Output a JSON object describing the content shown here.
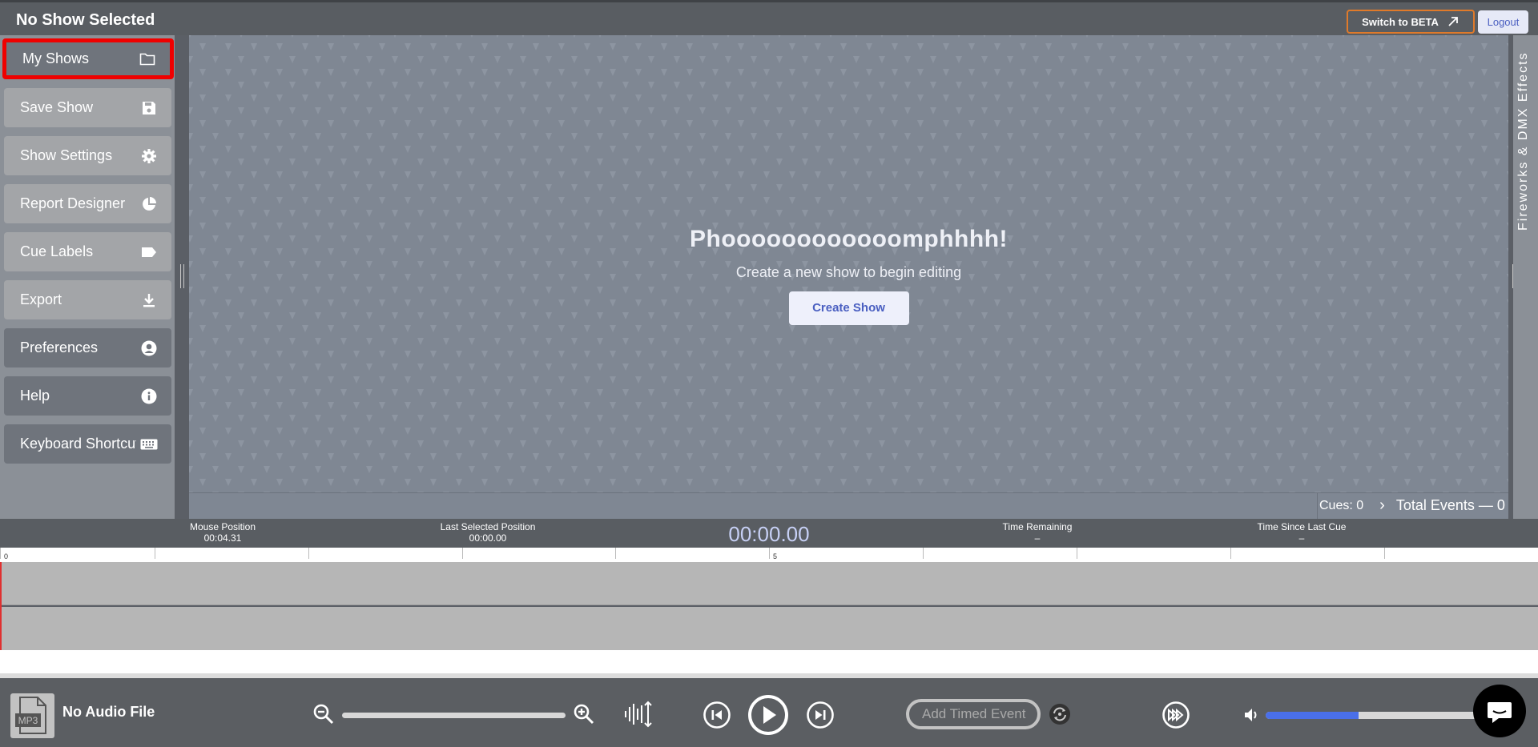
{
  "header": {
    "title": "No Show Selected",
    "beta_label": "Switch to BETA",
    "logout_label": "Logout"
  },
  "sidebar": {
    "items": [
      {
        "label": "My Shows",
        "icon": "folder-icon"
      },
      {
        "label": "Save Show",
        "icon": "save-icon"
      },
      {
        "label": "Show Settings",
        "icon": "gear-icon"
      },
      {
        "label": "Report Designer",
        "icon": "pie-chart-icon"
      },
      {
        "label": "Cue Labels",
        "icon": "label-icon"
      },
      {
        "label": "Export",
        "icon": "download-icon"
      },
      {
        "label": "Preferences",
        "icon": "user-circle-icon"
      },
      {
        "label": "Help",
        "icon": "info-icon"
      },
      {
        "label": "Keyboard Shortcuts",
        "icon": "keyboard-icon"
      }
    ]
  },
  "stage": {
    "headline": "Phoooooooooooomphhhh!",
    "subtitle": "Create a new show to begin editing",
    "create_label": "Create Show",
    "cues_label": "Cues: 0",
    "total_events_label": "Total Events — 0"
  },
  "effects_tab": {
    "label": "Fireworks & DMX Effects"
  },
  "status": {
    "mouse_position_label": "Mouse Position",
    "mouse_position_value": "00:04.31",
    "last_selected_label": "Last Selected Position",
    "last_selected_value": "00:00.00",
    "current_time": "00:00.00",
    "time_remaining_label": "Time Remaining",
    "time_remaining_value": "–",
    "time_since_label": "Time Since Last Cue",
    "time_since_value": "–"
  },
  "timeline": {
    "tick_label_0": "0",
    "tick_label_5": "5"
  },
  "player": {
    "mp3_label": "MP3",
    "audio_name": "No Audio File",
    "add_timed_event_placeholder": "Add Timed Event",
    "volume_fraction": 0.43
  }
}
